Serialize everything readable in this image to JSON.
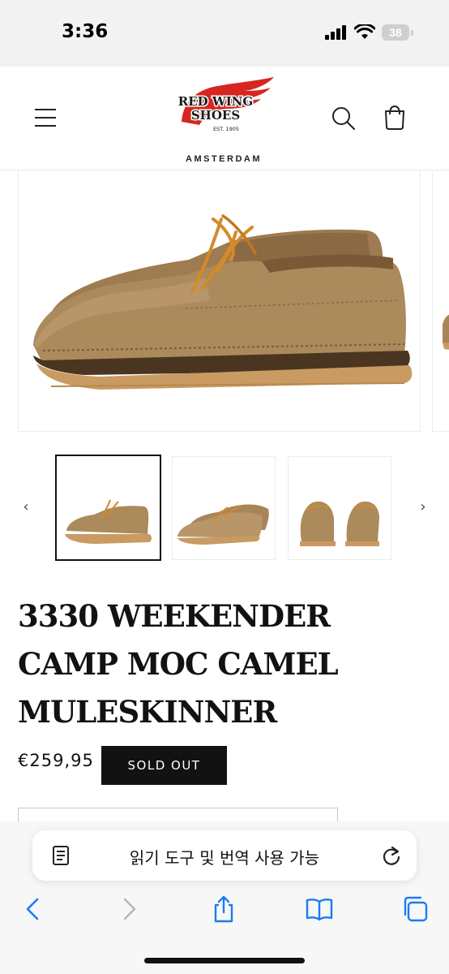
{
  "status_bar": {
    "time": "3:36",
    "battery": "38"
  },
  "header": {
    "brand_line1": "RED WING",
    "brand_line2": "SHOES",
    "brand_est": "EST. 1905",
    "location": "AMSTERDAM",
    "icons": [
      "menu-icon",
      "search-icon",
      "cart-icon"
    ]
  },
  "product": {
    "title_lines": [
      "3330 WEEKENDER",
      "CAMP MOC CAMEL",
      "MULESKINNER"
    ],
    "price": "€259,95",
    "status_badge": "SOLD OUT"
  },
  "gallery": {
    "prev_arrow": "‹",
    "next_arrow": "›",
    "thumbnails": [
      "side view pair",
      "angled pair",
      "front view pair"
    ],
    "selected_index": 0
  },
  "safari": {
    "reader_text": "읽기 도구 및 번역 사용 가능",
    "toolbar_icons": [
      "back-icon",
      "forward-icon",
      "share-icon",
      "bookmarks-icon",
      "tabs-icon"
    ]
  },
  "colors": {
    "accent_red": "#d7261f",
    "badge_bg": "#121212",
    "suede": "#a88559",
    "sole": "#c99a62",
    "ios_blue": "#1a7cf5"
  }
}
